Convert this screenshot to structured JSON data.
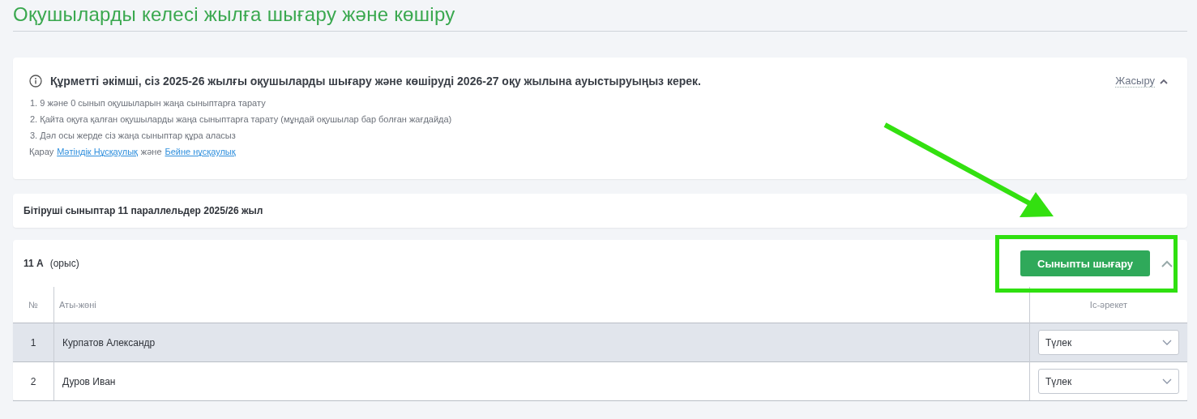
{
  "page_title": "Оқушыларды келесі жылға шығару және көшіру",
  "notice": {
    "heading": "Құрметті әкімші, сіз 2025-26 жылғы оқушыларды шығару және көшіруді 2026-27 оқу жылына ауыстыруыңыз керек.",
    "toggle": "Жасыру",
    "expanded": true,
    "steps": [
      "1. 9 және 0 сынып оқушыларын жаңа сыныптарға тарату",
      "2. Қайта оқуға қалған оқушыларды жаңа сыныптарға тарату (мұндай оқушылар бар болған жағдайда)",
      "3. Дәл осы жерде сіз жаңа сыныптар құра аласыз"
    ],
    "links_line": [
      {
        "kind": "text",
        "text": "Қарау"
      },
      {
        "kind": "link",
        "text": "Мәтіндік Нұсқаулық"
      },
      {
        "kind": "text",
        "text": "және"
      },
      {
        "kind": "link",
        "text": "Бейне нұсқаулық"
      }
    ]
  },
  "graduating_header": "Бітіруші сыныптар 11 параллельдер 2025/26 жыл",
  "class_panel": {
    "name": "11 А",
    "language": "(орыс)",
    "button": "Сыныпты шығару",
    "expanded": true,
    "columns": [
      "№",
      "Аты-жөні",
      "Іс-әрекет"
    ],
    "rows": [
      {
        "number": "1",
        "name": "Курпатов Александр",
        "action": "Түлек",
        "selected": true
      },
      {
        "number": "2",
        "name": "Дуров Иван",
        "action": "Түлек",
        "selected": false
      }
    ]
  },
  "annotations": [
    {
      "kind": "arrow"
    },
    {
      "kind": "frame"
    }
  ]
}
